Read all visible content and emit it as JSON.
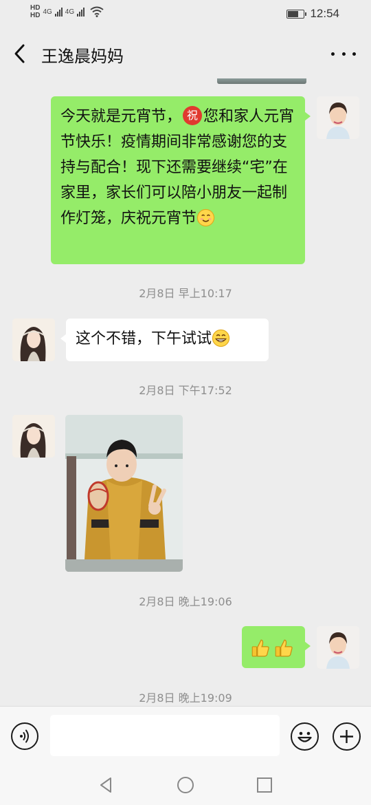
{
  "status_bar": {
    "hd_top": "HD",
    "hd_bottom": "HD",
    "net1": "4G",
    "net2": "4G",
    "time": "12:54",
    "battery_level": 0.7
  },
  "header": {
    "title": "王逸晨妈妈"
  },
  "messages": {
    "m1": {
      "sender": "self",
      "text_part1": "今天就是元宵节，",
      "badge": "祝",
      "text_part2": "您和家人元宵节快乐！疫情期间非常感谢您的支持与配合！现下还需要继续“宅”在家里，家长们可以陪小朋友一起制作灯笼，庆祝元宵节",
      "emoji": "smile-emoji"
    },
    "t1": "2月8日 早上10:17",
    "m2": {
      "sender": "parent",
      "text": "这个不错，下午试试",
      "emoji": "grin-emoji"
    },
    "t2": "2月8日 下午17:52",
    "m3": {
      "sender": "parent",
      "type": "photo"
    },
    "t3": "2月8日 晚上19:06",
    "m4": {
      "sender": "self",
      "emoji": [
        "thumbs-up-emoji",
        "thumbs-up-emoji"
      ]
    },
    "t4": "2月8日 晚上19:09"
  },
  "input_bar": {
    "text_value": "",
    "placeholder": ""
  },
  "colors": {
    "self_bubble": "#95ec69",
    "other_bubble": "#ffffff",
    "background": "#ededed",
    "badge": "#e03a2f"
  }
}
